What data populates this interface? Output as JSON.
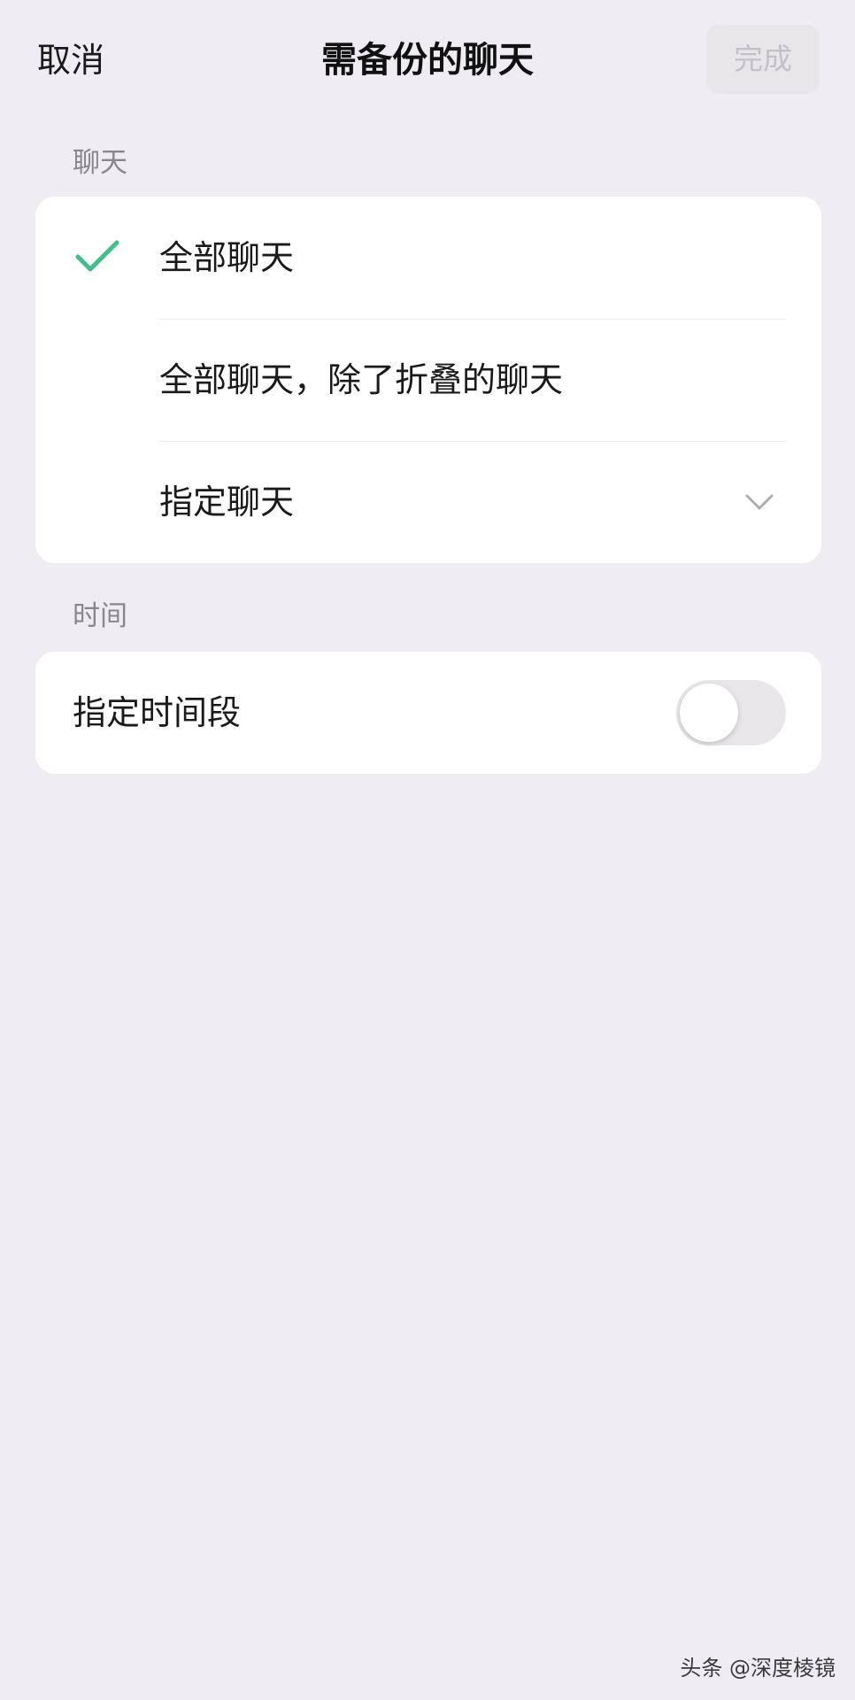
{
  "nav": {
    "cancel_label": "取消",
    "title": "需备份的聊天",
    "done_label": "完成"
  },
  "chat_section": {
    "label": "聊天",
    "options": [
      {
        "label": "全部聊天",
        "selected": true
      },
      {
        "label": "全部聊天，除了折叠的聊天",
        "selected": false
      },
      {
        "label": "指定聊天",
        "selected": false,
        "expandable": true
      }
    ]
  },
  "time_section": {
    "label": "时间",
    "row_label": "指定时间段",
    "toggle_on": false
  },
  "watermark": "头条 @深度棱镜",
  "colors": {
    "background": "#f0edf2",
    "card": "#ffffff",
    "accent_check": "#3fbf8a",
    "muted_text": "#8a878c",
    "done_disabled_text": "#c4c1c6"
  }
}
